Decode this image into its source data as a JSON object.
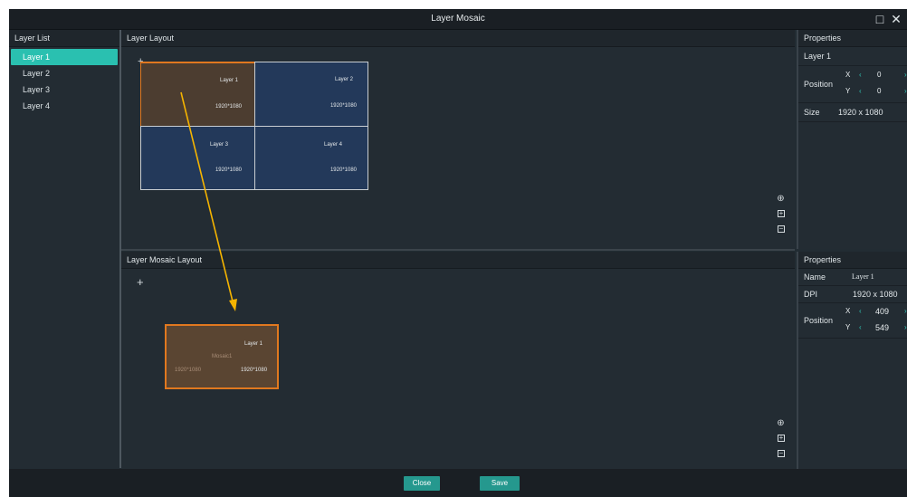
{
  "window": {
    "title": "Layer Mosaic",
    "controls": {
      "maximize": "□",
      "close": "✕"
    }
  },
  "sidebar": {
    "header": "Layer List",
    "items": [
      {
        "label": "Layer 1",
        "active": true
      },
      {
        "label": "Layer 2",
        "active": false
      },
      {
        "label": "Layer 3",
        "active": false
      },
      {
        "label": "Layer 4",
        "active": false
      }
    ]
  },
  "layer_layout": {
    "header": "Layer Layout",
    "cells": [
      {
        "name": "Layer 1",
        "resolution": "1920*1080",
        "selected": true
      },
      {
        "name": "Layer 2",
        "resolution": "1920*1080",
        "selected": false
      },
      {
        "name": "Layer 3",
        "resolution": "1920*1080",
        "selected": false
      },
      {
        "name": "Layer 4",
        "resolution": "1920*1080",
        "selected": false
      }
    ]
  },
  "mosaic_layout": {
    "header": "Layer Mosaic Layout",
    "add_symbol": "+",
    "block": {
      "layer_name": "Layer 1",
      "mosaic_name": "Mosaic1",
      "resolution_faded": "1920*1080",
      "resolution": "1920*1080"
    }
  },
  "properties_top": {
    "header": "Properties",
    "layer_name": "Layer 1",
    "position_label": "Position",
    "x_label": "X",
    "x_value": "0",
    "y_label": "Y",
    "y_value": "0",
    "size_label": "Size",
    "size_value": "1920 x 1080"
  },
  "properties_bottom": {
    "header": "Properties",
    "name_label": "Name",
    "name_value": "Layer 1",
    "dpi_label": "DPI",
    "dpi_value": "1920 x 1080",
    "position_label": "Position",
    "x_label": "X",
    "x_value": "409",
    "y_label": "Y",
    "y_value": "549"
  },
  "footer": {
    "close_label": "Close",
    "save_label": "Save"
  },
  "colors": {
    "accent": "#2ac0b0",
    "button": "#25988e",
    "selection_border": "#e0781f",
    "annotation_arrow": "#f5b400"
  }
}
